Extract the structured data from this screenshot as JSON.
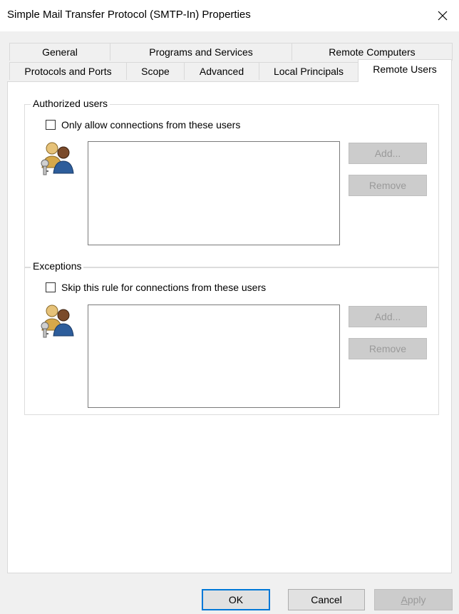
{
  "window": {
    "title": "Simple Mail Transfer Protocol (SMTP-In) Properties",
    "close_icon": "close-icon"
  },
  "tabs_back_row": [
    {
      "label": "General"
    },
    {
      "label": "Programs and Services"
    },
    {
      "label": "Remote Computers"
    }
  ],
  "tabs_front_row": [
    {
      "label": "Protocols and Ports"
    },
    {
      "label": "Scope"
    },
    {
      "label": "Advanced"
    },
    {
      "label": "Local Principals"
    },
    {
      "label": "Remote Users",
      "selected": true
    }
  ],
  "authorized": {
    "legend": "Authorized users",
    "checkbox_label": "Only allow connections from these users",
    "checked": false,
    "icon": "users-key-icon",
    "add_label": "Add...",
    "remove_label": "Remove",
    "items": []
  },
  "exceptions": {
    "legend": "Exceptions",
    "checkbox_label": "Skip this rule for connections from these users",
    "checked": false,
    "icon": "users-key-icon",
    "add_label": "Add...",
    "remove_label": "Remove",
    "items": []
  },
  "footer": {
    "ok_label": "OK",
    "cancel_label": "Cancel",
    "apply_label_first": "A",
    "apply_label_rest": "pply"
  },
  "colors": {
    "dialog_bg": "#f0f0f0",
    "panel_bg": "#ffffff",
    "focus_accent": "#0078d7",
    "disabled_button": "#cccccc"
  }
}
